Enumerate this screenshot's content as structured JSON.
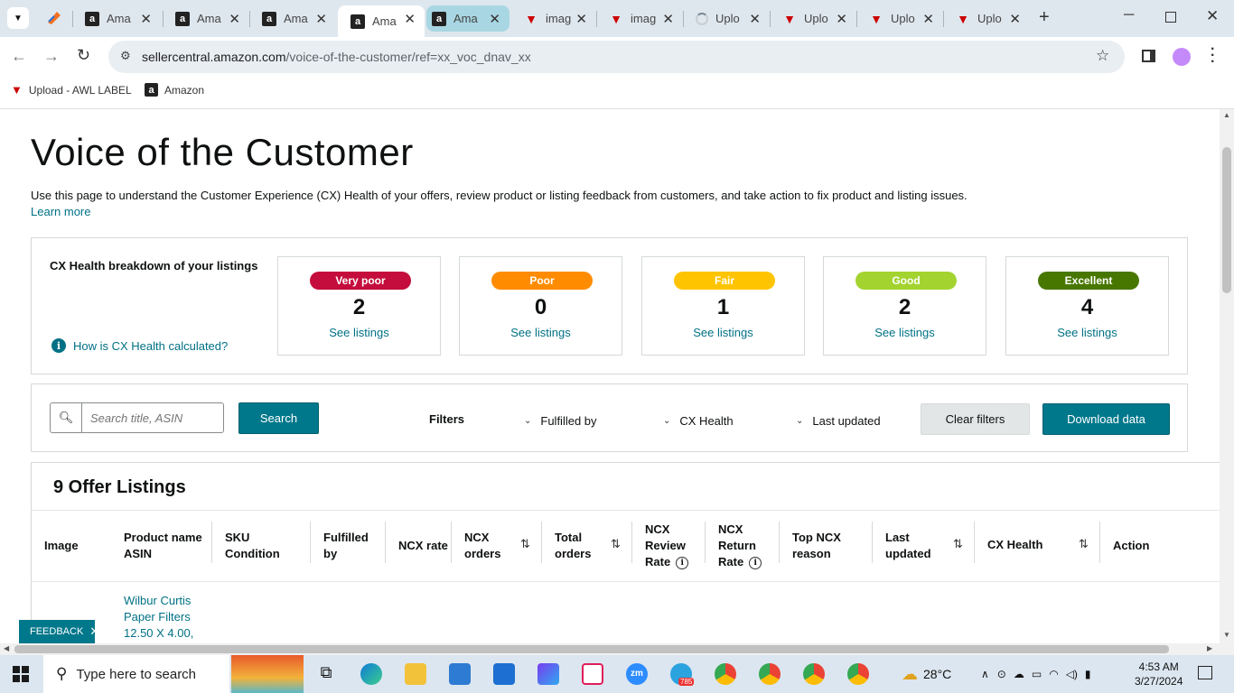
{
  "browser": {
    "tabs": [
      {
        "label": "Ama",
        "icon": "amazon"
      },
      {
        "label": "Ama",
        "icon": "amazon"
      },
      {
        "label": "Ama",
        "icon": "amazon"
      },
      {
        "label": "Ama",
        "icon": "amazon"
      },
      {
        "label": "Ama",
        "icon": "amazon"
      },
      {
        "label": "imag",
        "icon": "awl"
      },
      {
        "label": "imag",
        "icon": "awl"
      },
      {
        "label": "Uplo",
        "icon": "loading"
      },
      {
        "label": "Uplo",
        "icon": "awl"
      },
      {
        "label": "Uplo",
        "icon": "awl"
      },
      {
        "label": "Uplo",
        "icon": "awl"
      }
    ],
    "url_host": "sellercentral.amazon.com",
    "url_path": "/voice-of-the-customer/ref=xx_voc_dnav_xx",
    "bookmarks": [
      {
        "label": "Upload - AWL LABEL",
        "icon": "awl"
      },
      {
        "label": "Amazon",
        "icon": "amazon"
      }
    ]
  },
  "page": {
    "title": "Voice of the Customer",
    "description": "Use this page to understand the Customer Experience (CX) Health of your offers, review product or listing feedback from customers, and take action to fix product and listing issues.",
    "learn_more": "Learn more",
    "cx": {
      "title": "CX Health breakdown of your listings",
      "how_link": "How is CX Health calculated?",
      "cards": [
        {
          "label": "Very poor",
          "count": "2",
          "link": "See listings",
          "color": "#c40d3c",
          "text_color": "#ffffff"
        },
        {
          "label": "Poor",
          "count": "0",
          "link": "See listings",
          "color": "#ff8c00",
          "text_color": "#ffffff"
        },
        {
          "label": "Fair",
          "count": "1",
          "link": "See listings",
          "color": "#ffc400",
          "text_color": "#ffffff"
        },
        {
          "label": "Good",
          "count": "2",
          "link": "See listings",
          "color": "#a3d32f",
          "text_color": "#ffffff"
        },
        {
          "label": "Excellent",
          "count": "4",
          "link": "See listings",
          "color": "#487700",
          "text_color": "#ffffff"
        }
      ]
    },
    "filters": {
      "search_placeholder": "Search title, ASIN",
      "search_button": "Search",
      "label": "Filters",
      "dropdowns": [
        "Fulfilled by",
        "CX Health",
        "Last updated"
      ],
      "clear": "Clear filters",
      "download": "Download data"
    },
    "listings": {
      "title": "9 Offer Listings",
      "columns": {
        "image": "Image",
        "product_1": "Product name",
        "product_2": "ASIN",
        "sku_1": "SKU",
        "sku_2": "Condition",
        "fulfilled_1": "Fulfilled",
        "fulfilled_2": "by",
        "ncx_rate": "NCX rate",
        "ncx_orders_1": "NCX",
        "ncx_orders_2": "orders",
        "total_orders_1": "Total",
        "total_orders_2": "orders",
        "review_1": "NCX",
        "review_2": "Review",
        "review_3": "Rate",
        "return_1": "NCX",
        "return_2": "Return",
        "return_3": "Rate",
        "top_reason_1": "Top NCX",
        "top_reason_2": "reason",
        "last_updated_1": "Last",
        "last_updated_2": "updated",
        "cx_health": "CX Health",
        "action": "Action"
      },
      "rows": [
        {
          "product_name": "Wilbur Curtis Paper Filters 12.50 X 4.00,"
        }
      ]
    },
    "feedback": "FEEDBACK"
  },
  "taskbar": {
    "search_placeholder": "Type here to search",
    "weather": "28°C",
    "time": "4:53 AM",
    "date": "3/27/2024",
    "telegram_badge": "785"
  }
}
